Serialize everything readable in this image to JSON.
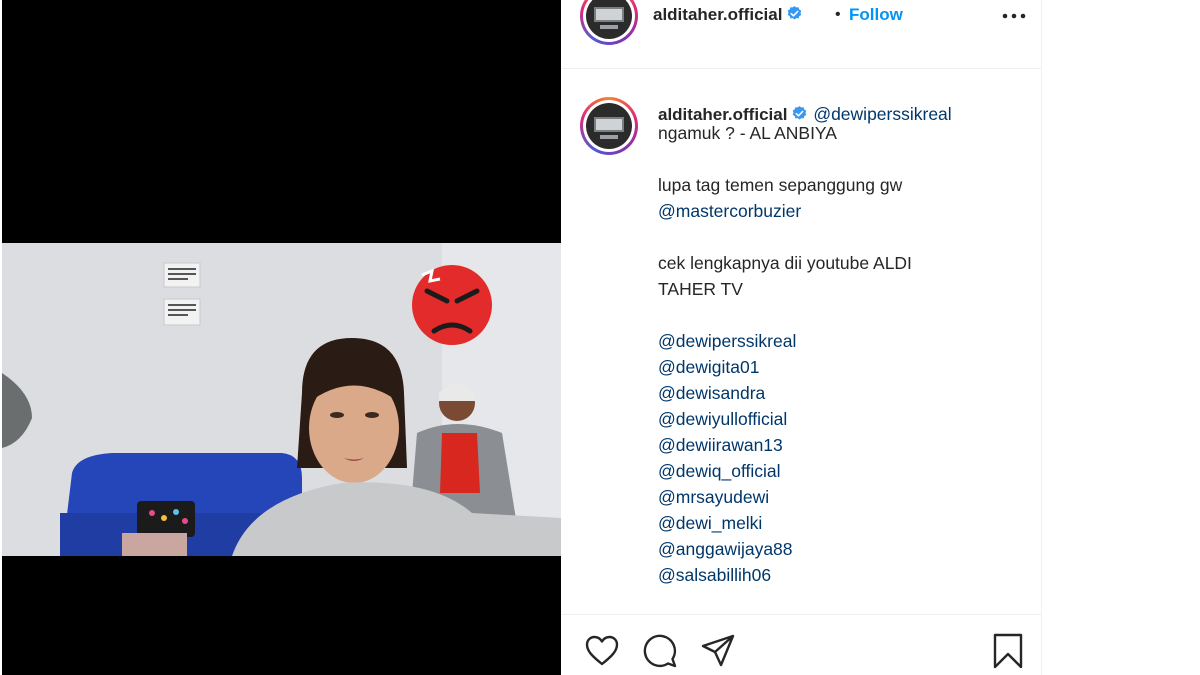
{
  "post": {
    "author": "alditaher.official",
    "follow_label": "Follow",
    "separator": "•",
    "caption": {
      "mention_head": "@dewiperssikreal",
      "line1": "ngamuk ? - AL ANBIYA",
      "line2": "lupa tag temen sepanggung gw",
      "line3_mention": "@mastercorbuzier",
      "line4a": "cek lengkapnya dii youtube ALDI",
      "line4b": "TAHER TV",
      "mentions": [
        "@dewiperssikreal",
        "@dewigita01",
        "@dewisandra",
        "@dewiyullofficial",
        "@dewiirawan13",
        "@dewiq_official",
        "@mrsayudewi",
        "@dewi_melki",
        "@anggawijaya88",
        "@salsabillih06"
      ]
    }
  },
  "icons": {
    "verified": "verified-badge-icon",
    "more": "more-options-icon",
    "like": "heart-icon",
    "comment": "comment-icon",
    "share": "paper-plane-icon",
    "save": "bookmark-icon",
    "overlay_emoji": "angry-face-emoji"
  },
  "colors": {
    "accent": "#0095f6",
    "mention": "#00376b",
    "text": "#262626",
    "emoji": "#e32b2b"
  }
}
